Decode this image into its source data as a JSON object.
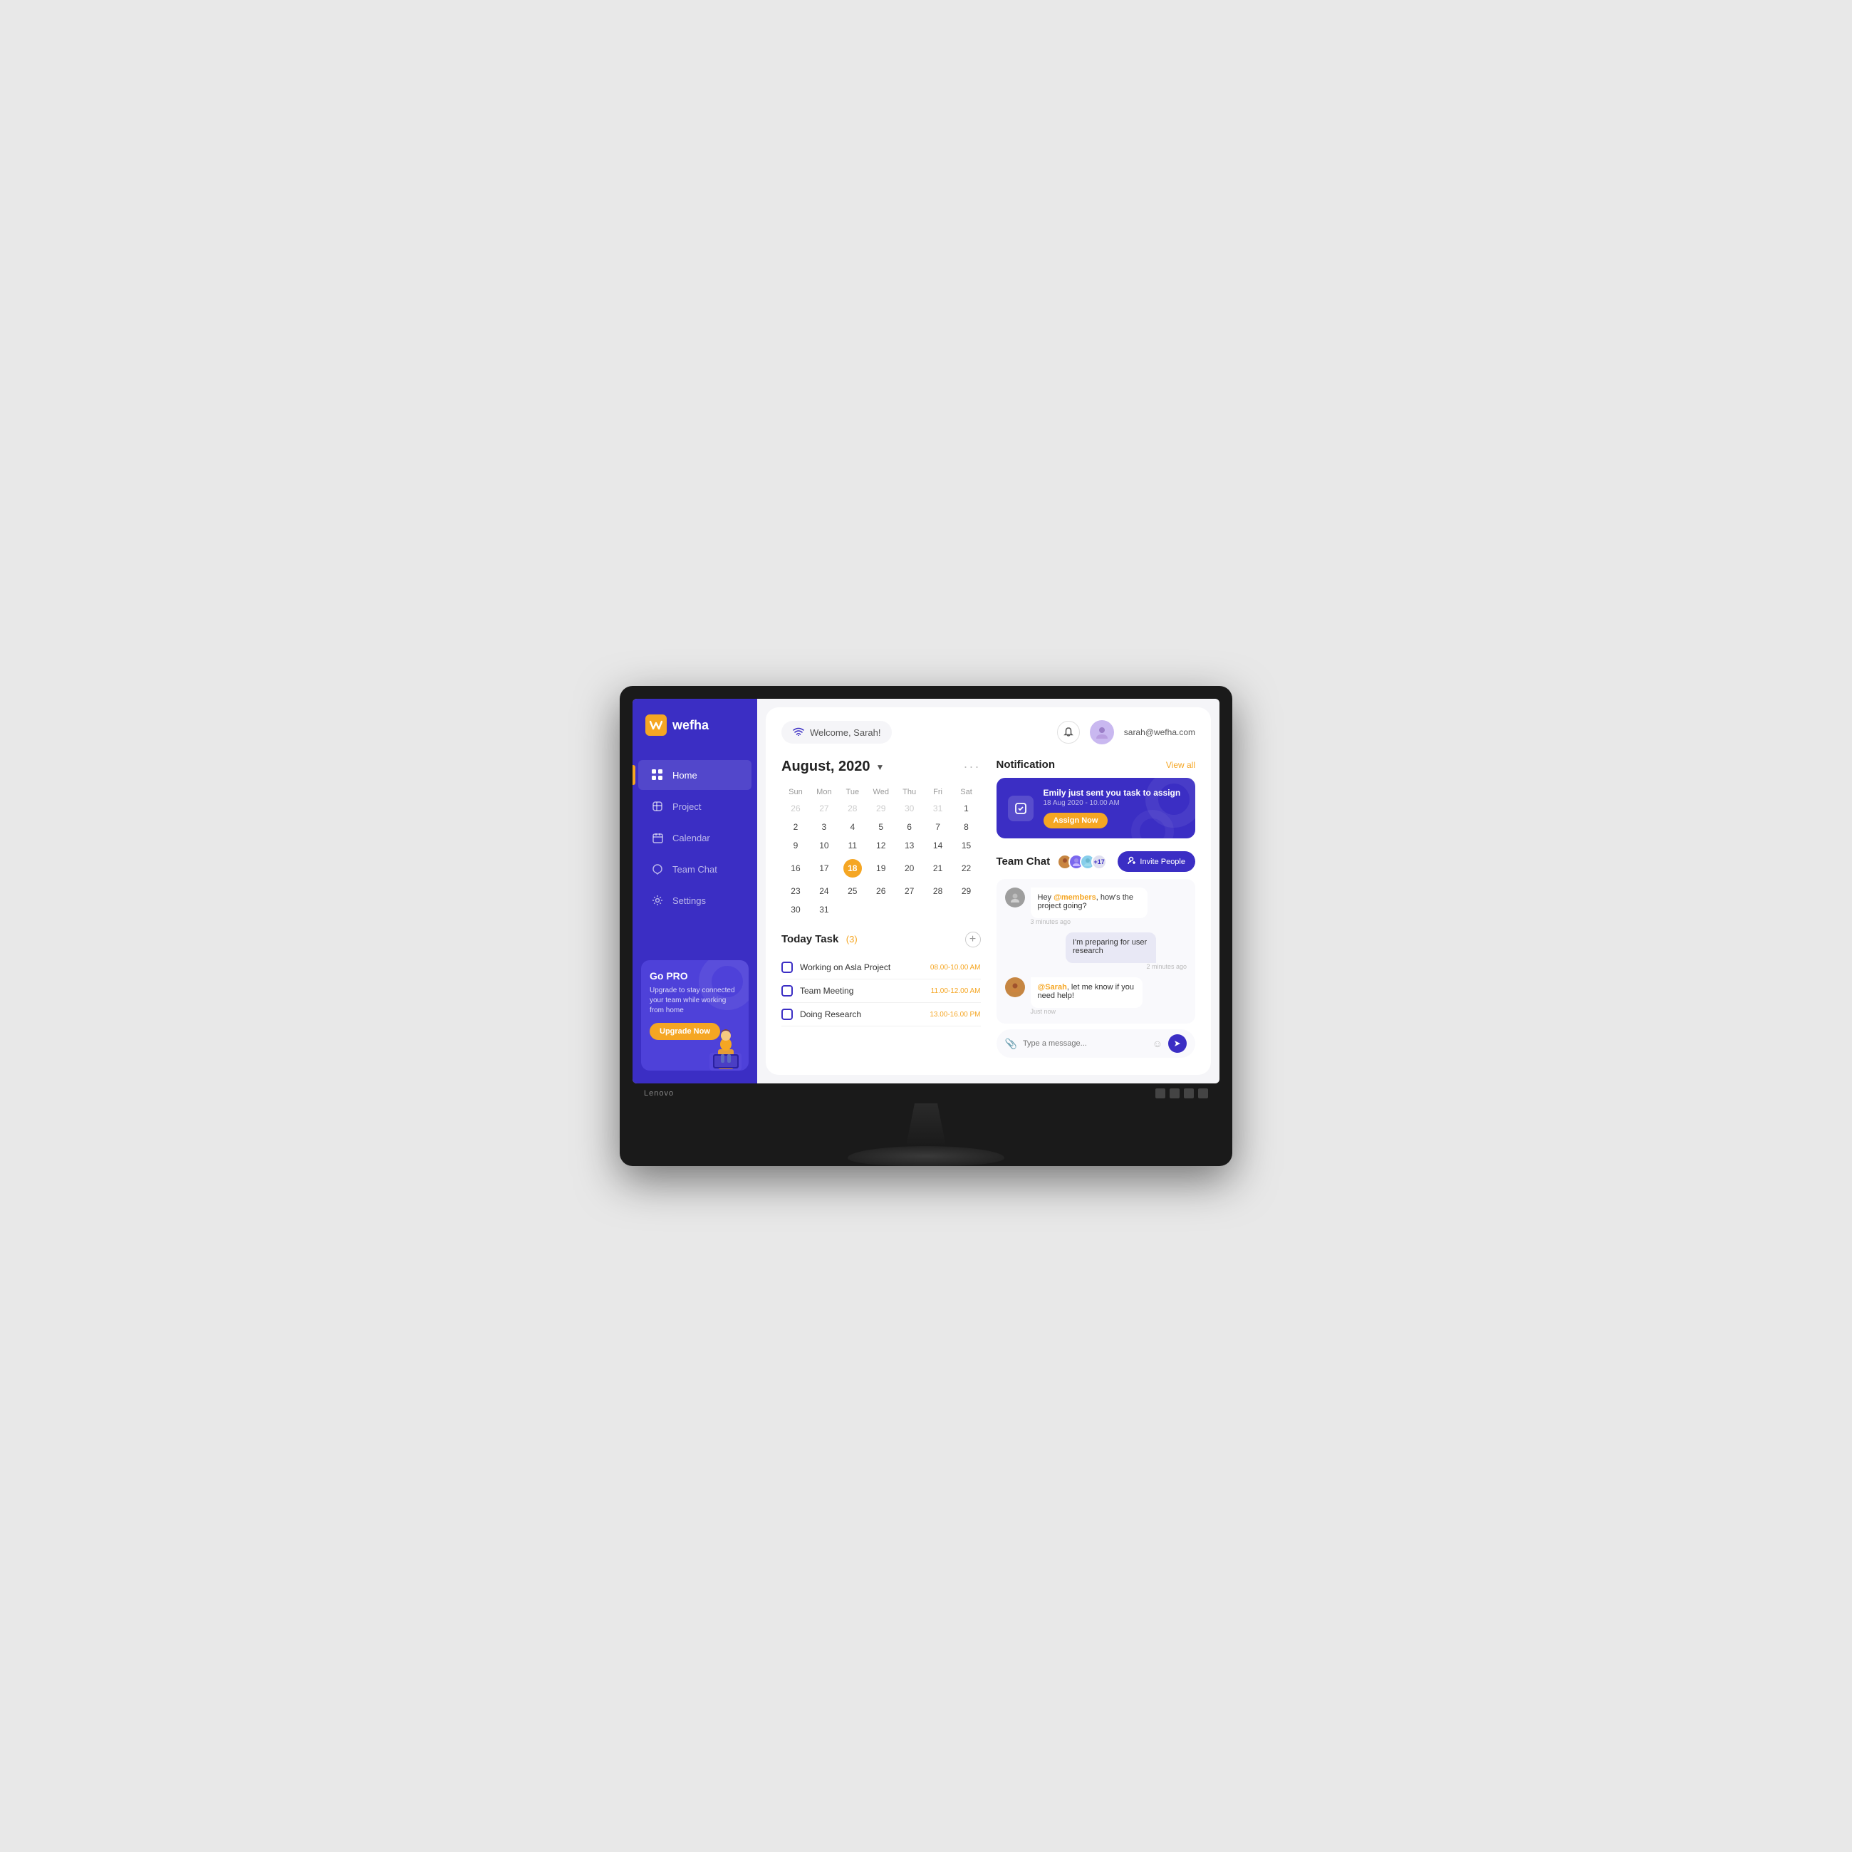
{
  "monitor": {
    "brand": "Lenovo"
  },
  "sidebar": {
    "logo_text": "wefha",
    "nav_items": [
      {
        "id": "home",
        "label": "Home",
        "icon": "⊞",
        "active": true
      },
      {
        "id": "project",
        "label": "Project",
        "icon": "◇",
        "active": false
      },
      {
        "id": "calendar",
        "label": "Calendar",
        "icon": "▦",
        "active": false
      },
      {
        "id": "team-chat",
        "label": "Team Chat",
        "icon": "◯",
        "active": false
      },
      {
        "id": "settings",
        "label": "Settings",
        "icon": "⚙",
        "active": false
      }
    ],
    "promo": {
      "title": "Go PRO",
      "description": "Upgrade to stay connected your team while working from home",
      "button_label": "Upgrade Now"
    }
  },
  "header": {
    "welcome_text": "Welcome, Sarah!",
    "user_email": "sarah@wefha.com"
  },
  "calendar": {
    "month_year": "August, 2020",
    "days_of_week": [
      "Sun",
      "Mon",
      "Tue",
      "Wed",
      "Thu",
      "Fri",
      "Sat"
    ],
    "weeks": [
      [
        "26",
        "27",
        "28",
        "29",
        "30",
        "31",
        "1"
      ],
      [
        "2",
        "3",
        "4",
        "5",
        "6",
        "7",
        "8"
      ],
      [
        "9",
        "10",
        "11",
        "12",
        "13",
        "14",
        "15"
      ],
      [
        "16",
        "17",
        "18",
        "19",
        "20",
        "21",
        "22"
      ],
      [
        "23",
        "24",
        "25",
        "26",
        "27",
        "28",
        "29"
      ],
      [
        "30",
        "31",
        "",
        "",
        "",
        "",
        ""
      ]
    ],
    "today": "18"
  },
  "tasks": {
    "title": "Today Task",
    "count": "3",
    "items": [
      {
        "name": "Working on Asla Project",
        "time": "08.00-10.00 AM"
      },
      {
        "name": "Team Meeting",
        "time": "11.00-12.00 AM"
      },
      {
        "name": "Doing Research",
        "time": "13.00-16.00 PM"
      }
    ]
  },
  "notification": {
    "section_title": "Notification",
    "view_all": "View all",
    "card": {
      "title": "Emily just sent you task to assign",
      "date": "18 Aug 2020 - 10.00 AM",
      "button_label": "Assign Now"
    }
  },
  "team_chat": {
    "title": "Team Chat",
    "members_count": "+17",
    "invite_button": "Invite People",
    "messages": [
      {
        "sender": "user1",
        "avatar_color": "#9e9e9e",
        "text_parts": [
          {
            "text": "Hey "
          },
          {
            "text": "@members",
            "mention": true
          },
          {
            "text": ", how's the project going?"
          }
        ],
        "time": "3 minutes ago",
        "align": "left"
      },
      {
        "sender": "me",
        "text": "I'm preparing for user research",
        "time": "2 minutes ago",
        "align": "right"
      },
      {
        "sender": "user2",
        "avatar_color": "#c68642",
        "text_parts": [
          {
            "text": "@Sarah",
            "mention": true
          },
          {
            "text": ", let me know if you need help!"
          }
        ],
        "time": "Just now",
        "align": "left"
      }
    ],
    "input_placeholder": "Type a message..."
  },
  "colors": {
    "primary": "#3b2ec4",
    "accent": "#f5a623",
    "sidebar_bg": "#3b2ec4"
  }
}
